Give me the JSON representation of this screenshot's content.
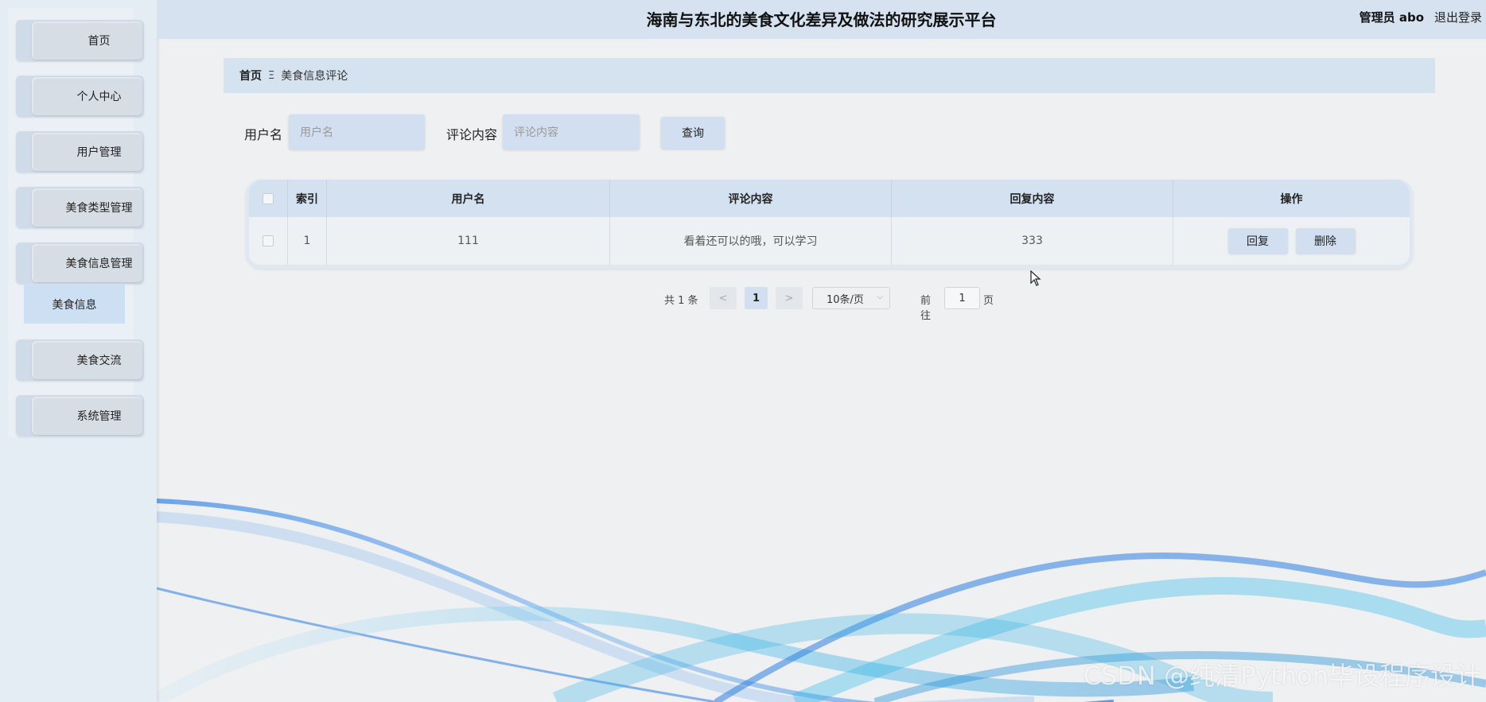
{
  "header": {
    "title": "海南与东北的美食文化差异及做法的研究展示平台",
    "admin_label": "管理员 abo",
    "logout_label": "退出登录"
  },
  "sidebar": {
    "items": [
      {
        "label": "首页"
      },
      {
        "label": "个人中心"
      },
      {
        "label": "用户管理"
      },
      {
        "label": "美食类型管理"
      },
      {
        "label": "美食信息管理"
      },
      {
        "label": "美食交流"
      },
      {
        "label": "系统管理"
      }
    ],
    "submenu": {
      "label": "美食信息"
    }
  },
  "breadcrumb": {
    "home": "首页",
    "separator": "Ξ",
    "current": "美食信息评论"
  },
  "search": {
    "username_label": "用户名",
    "username_placeholder": "用户名",
    "comment_label": "评论内容",
    "comment_placeholder": "评论内容",
    "query_label": "查询"
  },
  "table": {
    "headers": {
      "index": "索引",
      "username": "用户名",
      "comment": "评论内容",
      "reply": "回复内容",
      "actions": "操作"
    },
    "rows": [
      {
        "index": "1",
        "username": "111",
        "comment": "看着还可以的哦，可以学习",
        "reply": "333",
        "reply_button": "回复",
        "delete_button": "删除"
      }
    ]
  },
  "pagination": {
    "total": "共 1 条",
    "prev": "<",
    "current_page": "1",
    "next": ">",
    "page_size": "10条/页",
    "goto_label": "前往",
    "goto_value": "1",
    "goto_unit": "页"
  },
  "watermark": "CSDN @纯清Python毕设程序设计",
  "colors": {
    "sidebar": "#e4ecf4",
    "header": "#d6e2ef",
    "accent": "#d2dff0",
    "wave_blue": "#2f7fe0",
    "wave_cyan": "#29b6e8"
  }
}
